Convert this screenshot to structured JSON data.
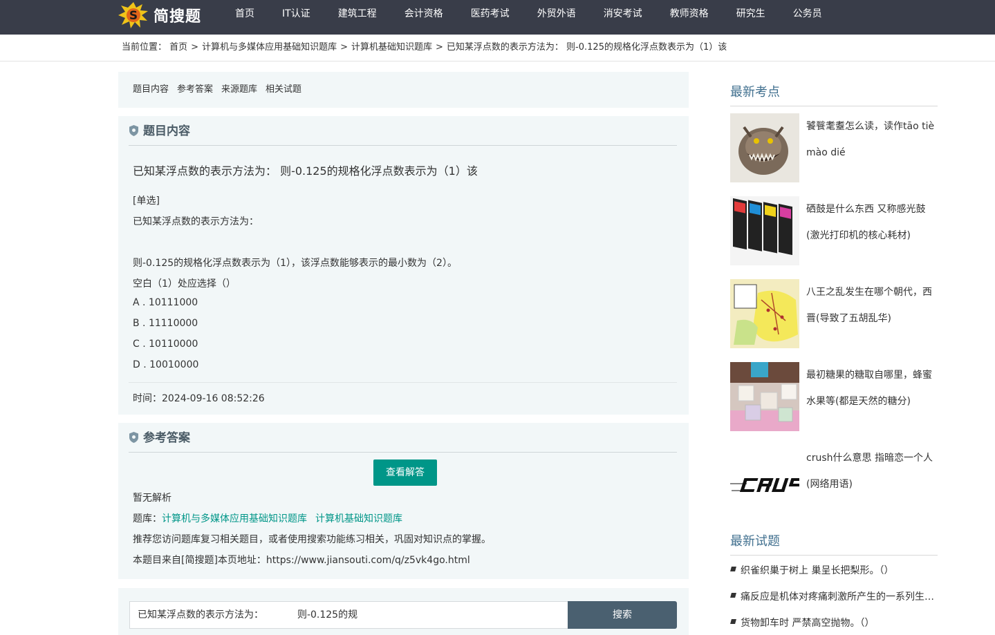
{
  "site": {
    "logo_text": "简搜题"
  },
  "nav": [
    "首页",
    "IT认证",
    "建筑工程",
    "会计资格",
    "医药考试",
    "外贸外语",
    "消安考试",
    "教师资格",
    "研究生",
    "公务员"
  ],
  "breadcrumb": {
    "prefix": "当前位置：",
    "items": [
      "首页",
      "计算机与多媒体应用基础知识题库",
      "计算机基础知识题库",
      "已知某浮点数的表示方法为：  则-0.125的规格化浮点数表示为（1）该"
    ],
    "sep": ">"
  },
  "tabs": [
    "题目内容",
    "参考答案",
    "来源题库",
    "相关试题"
  ],
  "question": {
    "section_title": "题目内容",
    "title": "已知某浮点数的表示方法为：  则-0.125的规格化浮点数表示为（1）该",
    "type": "[单选]",
    "stem1": "已知某浮点数的表示方法为：",
    "stem2": "则-0.125的规格化浮点数表示为（1），该浮点数能够表示的最小数为（2）。",
    "blank": "空白（1）处应选择（）",
    "options": [
      "A . 10111000",
      "B . 11110000",
      "C . 10110000",
      "D . 10010000"
    ],
    "time": "时间：2024-09-16 08:52:26"
  },
  "answer": {
    "section_title": "参考答案",
    "button": "查看解答",
    "analysis": "暂无解析",
    "bank_label": "题库：",
    "banks": [
      "计算机与多媒体应用基础知识题库",
      "计算机基础知识题库"
    ],
    "recommend": "推荐您访问题库复习相关题目，或者使用搜索功能练习相关，巩固对知识点的掌握。",
    "source": "本题目来自[简搜题]本页地址：https://www.jiansouti.com/q/z5vk4go.html"
  },
  "search": {
    "value": "已知某浮点数的表示方法为：           则-0.125的规",
    "button": "搜索"
  },
  "sidebar": {
    "kp_title": "最新考点",
    "kp_items": [
      "饕餮耄耋怎么读，读作tāo tiè mào dié",
      "硒鼓是什么东西 又称感光鼓(激光打印机的核心耗材)",
      "八王之乱发生在哪个朝代，西晋(导致了五胡乱华)",
      "最初糖果的糖取自哪里，蜂蜜水果等(都是天然的糖分)",
      "crush什么意思 指暗恋一个人(网络用语)"
    ],
    "nq_title": "最新试题",
    "nq_items": [
      "织雀织巢于树上 巢呈长把梨形。（）",
      "痛反应是机体对疼痛刺激所产生的一系列生理、病理变化和心理变化",
      "货物卸车时 严禁高空抛物。（）"
    ]
  },
  "colors": {
    "topbar": "#393d49",
    "accent": "#009688",
    "search_btn": "#4a6070",
    "panel_bg": "#f2f7f8",
    "side_title": "#41708f"
  }
}
